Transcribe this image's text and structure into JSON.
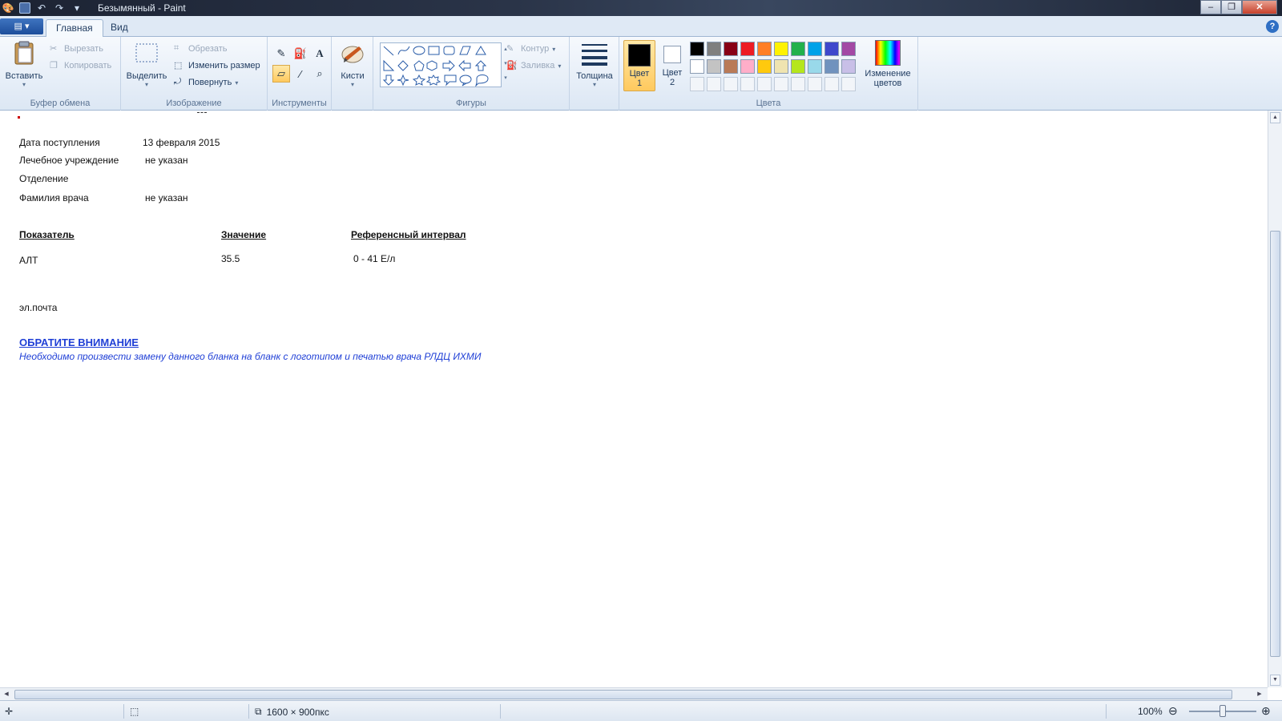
{
  "window": {
    "title": "Безымянный - Paint",
    "controls": [
      "minimize",
      "maximize",
      "close"
    ]
  },
  "tabs": [
    {
      "label": "Главная",
      "active": true
    },
    {
      "label": "Вид",
      "active": false
    }
  ],
  "ribbon": {
    "clipboard": {
      "group_label": "Буфер обмена",
      "paste": "Вставить",
      "cut": "Вырезать",
      "copy": "Копировать"
    },
    "image": {
      "group_label": "Изображение",
      "select": "Выделить",
      "crop": "Обрезать",
      "resize": "Изменить размер",
      "rotate": "Повернуть"
    },
    "tools": {
      "group_label": "Инструменты"
    },
    "brushes": {
      "label": "Кисти"
    },
    "shapes": {
      "group_label": "Фигуры",
      "outline": "Контур",
      "fill": "Заливка"
    },
    "size": {
      "label": "Толщина"
    },
    "colors": {
      "group_label": "Цвета",
      "color1_line1": "Цвет",
      "color1_line2": "1",
      "color2_line1": "Цвет",
      "color2_line2": "2",
      "edit_line1": "Изменение",
      "edit_line2": "цветов",
      "color1_value": "#000000",
      "color2_value": "#ffffff",
      "palette_row1": [
        "#000000",
        "#7f7f7f",
        "#880015",
        "#ed1c24",
        "#ff7f27",
        "#fff200",
        "#22b14c",
        "#00a2e8",
        "#3f48cc",
        "#a349a4"
      ],
      "palette_row2": [
        "#ffffff",
        "#c3c3c3",
        "#b97a57",
        "#ffaec9",
        "#ffc90e",
        "#efe4b0",
        "#b5e61d",
        "#99d9ea",
        "#7092be",
        "#c8bfe7"
      ]
    }
  },
  "document": {
    "fields": [
      {
        "label": "Дата поступления",
        "value": "13 февраля 2015"
      },
      {
        "label": "Лечебное учреждение",
        "value": "не указан"
      },
      {
        "label": "Отделение",
        "value": ""
      },
      {
        "label": "Фамилия врача",
        "value": "не указан"
      }
    ],
    "table_headers": {
      "indicator": "Показатель",
      "value": "Значение",
      "reference": "Референсный интервал"
    },
    "table_row": {
      "indicator": "АЛТ",
      "value": "35.5",
      "reference": "0 - 41 Е/л"
    },
    "email_label": "эл.почта",
    "notice_title": "ОБРАТИТЕ ВНИМАНИЕ",
    "notice_message": "Необходимо произвести замену данного бланка на бланк с логотипом и печатью врача РЛДЦ ИХМИ"
  },
  "statusbar": {
    "image_size": "1600 × 900пкс",
    "zoom": "100%"
  }
}
